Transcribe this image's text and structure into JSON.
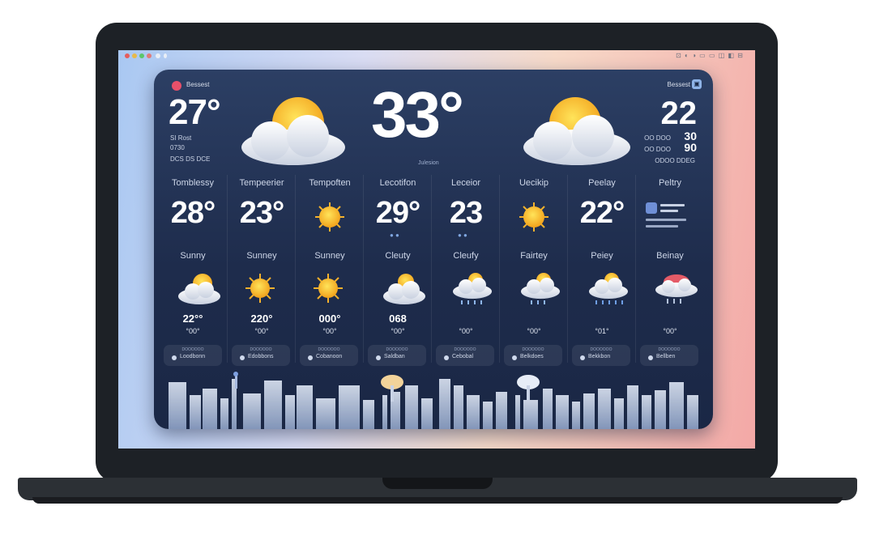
{
  "status_bar": {
    "right_icons": "⊡ ◐ ◑ ▭ ▭ ◫ ◧ ⊟"
  },
  "app": {
    "top_left_label": "Bessest",
    "top_right_label": "Bessest",
    "current_left": {
      "temp": "27°",
      "lines": [
        "SI Rost",
        "0730",
        "DCS DS  DCE"
      ]
    },
    "current_center": {
      "temp": "33°",
      "caption": "Julesion"
    },
    "current_right": {
      "temp": "22",
      "side_values": [
        "30",
        "90"
      ],
      "lines": [
        "OO DOO",
        "OO DOO",
        "ODOO DDEG"
      ]
    }
  },
  "columns": [
    {
      "header": "Tomblessy",
      "temp": "28°",
      "condition": "Sunny",
      "icon": "sun-cloud-icon",
      "hi": "22°°",
      "lo": "°00°"
    },
    {
      "header": "Tempeerier",
      "temp": "23°",
      "condition": "Sunney",
      "icon": "sun-icon",
      "hi": "220°",
      "lo": "°00°"
    },
    {
      "header": "Tempoften",
      "temp": "",
      "condition": "Sunney",
      "icon": "sun-icon",
      "hi": "000°",
      "lo": "°00°"
    },
    {
      "header": "Lecotifon",
      "temp": "29°",
      "condition": "Cleuty",
      "icon": "partly-cloudy-icon",
      "hi": "068",
      "lo": "°00°"
    },
    {
      "header": "Leceior",
      "temp": "23",
      "condition": "Cleufy",
      "icon": "rain-cloud-icon",
      "hi": "",
      "lo": "°00°"
    },
    {
      "header": "Uecikip",
      "temp": "",
      "condition": "Fairtey",
      "icon": "rain-cloud-icon",
      "hi": "",
      "lo": "°00°"
    },
    {
      "header": "Peelay",
      "temp": "22°",
      "condition": "Peiey",
      "icon": "rain-cloud-icon",
      "hi": "",
      "lo": "°01°"
    },
    {
      "header": "Peltry",
      "temp": "",
      "condition": "Beinay",
      "icon": "storm-cloud-icon",
      "hi": "",
      "lo": "°00°"
    }
  ],
  "pills": [
    {
      "top": "DOOOOOO",
      "text": "Loodbonn"
    },
    {
      "top": "DOOOOOO",
      "text": "Edobbons"
    },
    {
      "top": "DOOOOOO",
      "text": "Cobanoon"
    },
    {
      "top": "DOOOOOO",
      "text": "Saldban"
    },
    {
      "top": "DOOOOOO",
      "text": "Cebobal"
    },
    {
      "top": "DOOOOOO",
      "text": "Belkdoes"
    },
    {
      "top": "DOOOOOO",
      "text": "Bekkbon"
    },
    {
      "top": "DOOOOOO",
      "text": "Bellben"
    }
  ]
}
